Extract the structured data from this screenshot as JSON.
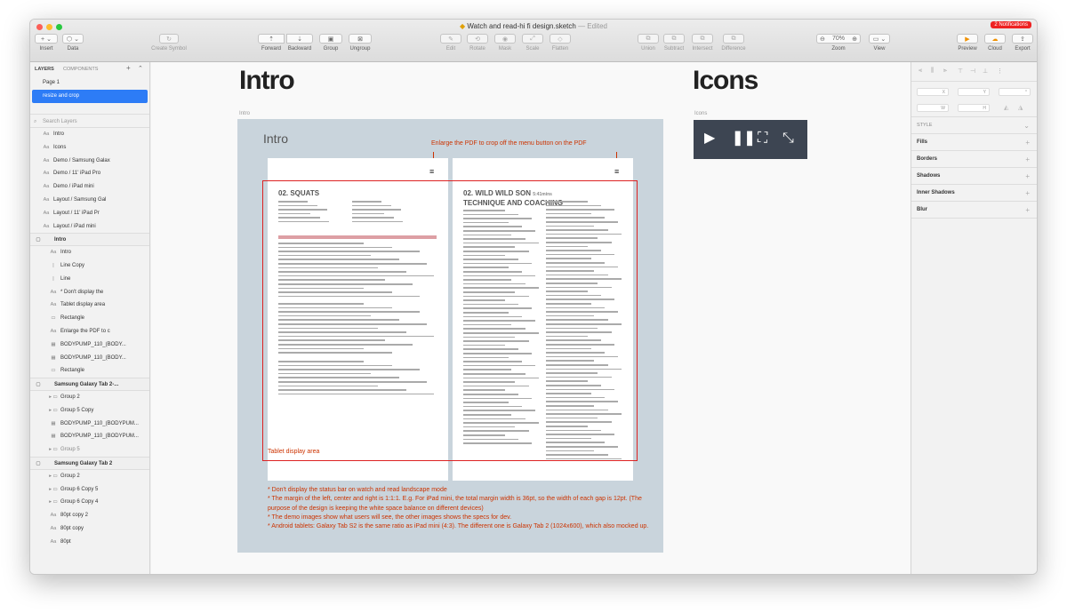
{
  "window": {
    "title": "Watch and read-hi fi design.sketch",
    "edited": "— Edited",
    "notifications": "2 Notifications"
  },
  "toolbar": {
    "insert": "Insert",
    "data": "Data",
    "create_symbol": "Create Symbol",
    "forward": "Forward",
    "backward": "Backward",
    "group": "Group",
    "ungroup": "Ungroup",
    "edit": "Edit",
    "rotate": "Rotate",
    "mask": "Mask",
    "scale": "Scale",
    "flatten": "Flatten",
    "union": "Union",
    "subtract": "Subtract",
    "intersect": "Intersect",
    "difference": "Difference",
    "zoom_label": "Zoom",
    "zoom_value": "70%",
    "view": "View",
    "preview": "Preview",
    "cloud": "Cloud",
    "export": "Export"
  },
  "left_panel": {
    "tab_layers": "LAYERS",
    "tab_components": "COMPONENTS",
    "pages": [
      "Page 1",
      "resize and crop"
    ],
    "search_placeholder": "Search Layers",
    "layers": [
      {
        "icon": "Aa",
        "name": "Intro",
        "indent": 1
      },
      {
        "icon": "Aa",
        "name": "Icons",
        "indent": 1
      },
      {
        "icon": "Aa",
        "name": "Demo / Samsung Galax",
        "indent": 1
      },
      {
        "icon": "Aa",
        "name": "Demo / 11' iPad Pro",
        "indent": 1
      },
      {
        "icon": "Aa",
        "name": "Demo / iPad mini",
        "indent": 1
      },
      {
        "icon": "Aa",
        "name": "Layout / Samsung Gal",
        "indent": 1
      },
      {
        "icon": "Aa",
        "name": "Layout / 11' iPad Pr",
        "indent": 1
      },
      {
        "icon": "Aa",
        "name": "Layout / iPad mini",
        "indent": 1
      },
      {
        "icon": "▢",
        "name": "Intro",
        "indent": 0,
        "group": true
      },
      {
        "icon": "Aa",
        "name": "Intro",
        "indent": 2
      },
      {
        "icon": "|",
        "name": "Line Copy",
        "indent": 2
      },
      {
        "icon": "|",
        "name": "Line",
        "indent": 2
      },
      {
        "icon": "Aa",
        "name": "* Don't display the",
        "indent": 2
      },
      {
        "icon": "Aa",
        "name": "Tablet display area",
        "indent": 2
      },
      {
        "icon": "▭",
        "name": "Rectangle",
        "indent": 2
      },
      {
        "icon": "Aa",
        "name": "Enlarge the PDF to c",
        "indent": 2
      },
      {
        "icon": "▦",
        "name": "BODYPUMP_110_(BODY...",
        "indent": 2
      },
      {
        "icon": "▦",
        "name": "BODYPUMP_110_(BODY...",
        "indent": 2
      },
      {
        "icon": "▭",
        "name": "Rectangle",
        "indent": 2
      },
      {
        "icon": "▢",
        "name": "Samsung Galaxy Tab 2-...",
        "indent": 0,
        "group": true
      },
      {
        "icon": "▸ ▭",
        "name": "Group 2",
        "indent": 2
      },
      {
        "icon": "▸ ▭",
        "name": "Group 5 Copy",
        "indent": 2
      },
      {
        "icon": "▦",
        "name": "BODYPUMP_110_(BODYPUM...",
        "indent": 2
      },
      {
        "icon": "▦",
        "name": "BODYPUMP_110_(BODYPUM...",
        "indent": 2
      },
      {
        "icon": "▸ ▭",
        "name": "Group 5",
        "indent": 2,
        "dim": true
      },
      {
        "icon": "▢",
        "name": "Samsung Galaxy Tab 2",
        "indent": 0,
        "group": true
      },
      {
        "icon": "▸ ▭",
        "name": "Group 2",
        "indent": 2
      },
      {
        "icon": "▸ ▭",
        "name": "Group 6 Copy 5",
        "indent": 2
      },
      {
        "icon": "▸ ▭",
        "name": "Group 6 Copy 4",
        "indent": 2
      },
      {
        "icon": "Aa",
        "name": "80pt copy 2",
        "indent": 2
      },
      {
        "icon": "Aa",
        "name": "80pt copy",
        "indent": 2
      },
      {
        "icon": "Aa",
        "name": "80pt",
        "indent": 2
      }
    ]
  },
  "canvas": {
    "heading_intro": "Intro",
    "heading_icons": "Icons",
    "artboard_intro_label": "Intro",
    "artboard_icons_label": "Icons",
    "artboard_title": "Intro",
    "enlarge_note": "Enlarge the PDF to crop off the menu button on the PDF",
    "tablet_label": "Tablet display area",
    "left_page_title": "02. SQUATS",
    "right_page_title": "02. WILD WILD SON",
    "right_page_duration": "5:41mins",
    "right_page_subtitle": "TECHNIQUE AND COACHING",
    "notes": [
      "* Don't display the status bar on watch and read landscape mode",
      "* The margin of the left, center and right is 1:1:1. E.g. For iPad mini, the total margin width is 36pt, so the width of each gap is 12pt. (The purpose of the design is keeping the white space balance on different devices)",
      "* The demo images show what users will see, the other images shows the specs for dev.",
      "* Android tablets: Galaxy Tab S2 is the same ratio as iPad mini (4:3). The different one is Galaxy Tab 2 (1024x600), which also mocked up."
    ]
  },
  "right_panel": {
    "style": "STYLE",
    "fills": "Fills",
    "borders": "Borders",
    "shadows": "Shadows",
    "inner_shadows": "Inner Shadows",
    "blur": "Blur"
  },
  "colors": {
    "accent": "#2d7cf6",
    "annotation": "#cc3300",
    "artboard_bg": "#c9d4dc",
    "icons_bg": "#3d4552"
  }
}
